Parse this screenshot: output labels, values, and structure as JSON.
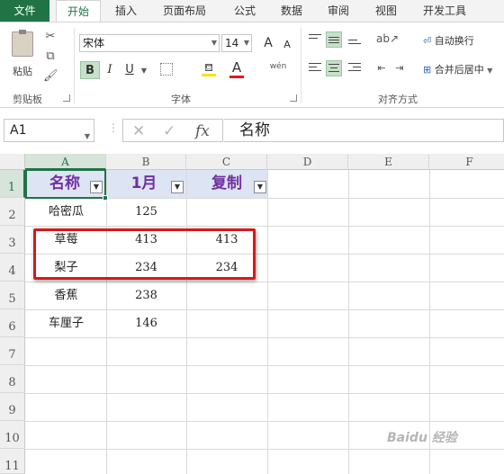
{
  "ribbon_tabs": [
    "文件",
    "开始",
    "插入",
    "页面布局",
    "公式",
    "数据",
    "审阅",
    "视图",
    "开发工具"
  ],
  "clipboard": {
    "paste_label": "粘贴",
    "group_label": "剪贴板"
  },
  "font": {
    "name": "宋体",
    "size": "14",
    "grow_label": "A",
    "shrink_label": "A",
    "bold_label": "B",
    "italic_label": "I",
    "underline_label": "U",
    "font_color_label": "A",
    "phonetic_label": "wén",
    "group_label": "字体",
    "font_color": "#e41b1b",
    "fill_color": "#ffe100"
  },
  "alignment": {
    "wrap_label": "自动换行",
    "merge_label": "合并后居中",
    "group_label": "对齐方式"
  },
  "formula_bar": {
    "name_box": "A1",
    "fx_label": "fx",
    "content": "名称"
  },
  "sheet": {
    "columns": [
      "A",
      "B",
      "C",
      "D",
      "E",
      "F"
    ],
    "rows": [
      "1",
      "2",
      "3",
      "4",
      "5",
      "6",
      "7",
      "8",
      "9",
      "10",
      "11"
    ],
    "headers": [
      "名称",
      "1月",
      "复制"
    ],
    "data": [
      [
        "哈密瓜",
        "125",
        ""
      ],
      [
        "草莓",
        "413",
        "413"
      ],
      [
        "梨子",
        "234",
        "234"
      ],
      [
        "香蕉",
        "238",
        ""
      ],
      [
        "车厘子",
        "146",
        ""
      ]
    ],
    "header_color": "#7030a0",
    "header_band_color": "#dde4f3",
    "highlight_border_color": "#d8191b"
  },
  "watermark": "Baidu 经验"
}
